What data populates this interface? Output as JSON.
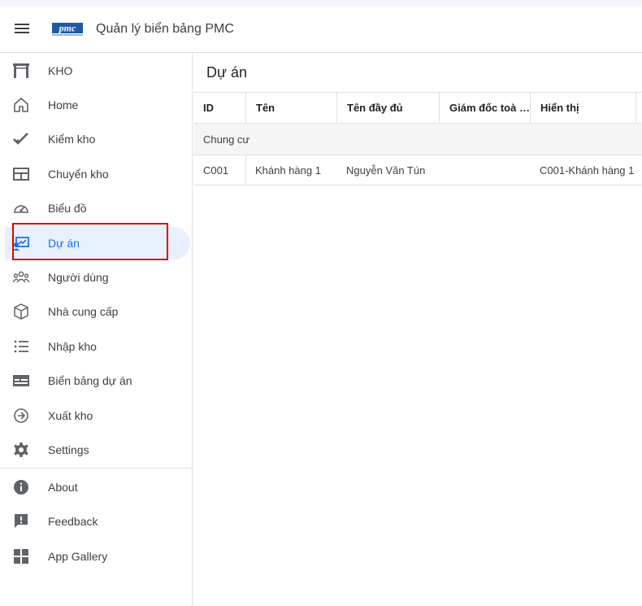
{
  "app": {
    "title": "Quản lý biển bảng PMC",
    "logo_text": "pmc",
    "brand_color": "#1a73e8"
  },
  "sidebar": {
    "items": [
      {
        "label": "KHO",
        "icon": "warehouse-icon"
      },
      {
        "label": "Home",
        "icon": "home-icon"
      },
      {
        "label": "Kiểm kho",
        "icon": "check-icon"
      },
      {
        "label": "Chuyển kho",
        "icon": "table-icon"
      },
      {
        "label": "Biểu đồ",
        "icon": "gauge-icon"
      },
      {
        "label": "Dự án",
        "icon": "project-icon",
        "active": true
      },
      {
        "label": "Người dùng",
        "icon": "people-icon"
      },
      {
        "label": "Nhà cung cấp",
        "icon": "box-icon"
      },
      {
        "label": "Nhập kho",
        "icon": "list-icon"
      },
      {
        "label": "Biển bảng dự án",
        "icon": "card-icon"
      },
      {
        "label": "Xuất kho",
        "icon": "arrow-circle-icon"
      },
      {
        "label": "Settings",
        "icon": "gear-icon"
      }
    ],
    "footer_items": [
      {
        "label": "About",
        "icon": "info-icon"
      },
      {
        "label": "Feedback",
        "icon": "feedback-icon"
      },
      {
        "label": "App Gallery",
        "icon": "grid-icon"
      }
    ]
  },
  "main": {
    "page_title": "Dự án",
    "columns": [
      "ID",
      "Tên",
      "Tên đầy đủ",
      "Giám đốc toà nhà",
      "Hiển thị"
    ],
    "group_label": "Chung cư",
    "rows": [
      {
        "id": "C001",
        "ten": "Khánh hàng 1",
        "ten_day_du": "Nguyễn Văn Tún",
        "giam_doc": "",
        "hien_thi": "C001-Khánh hàng 1"
      }
    ]
  }
}
